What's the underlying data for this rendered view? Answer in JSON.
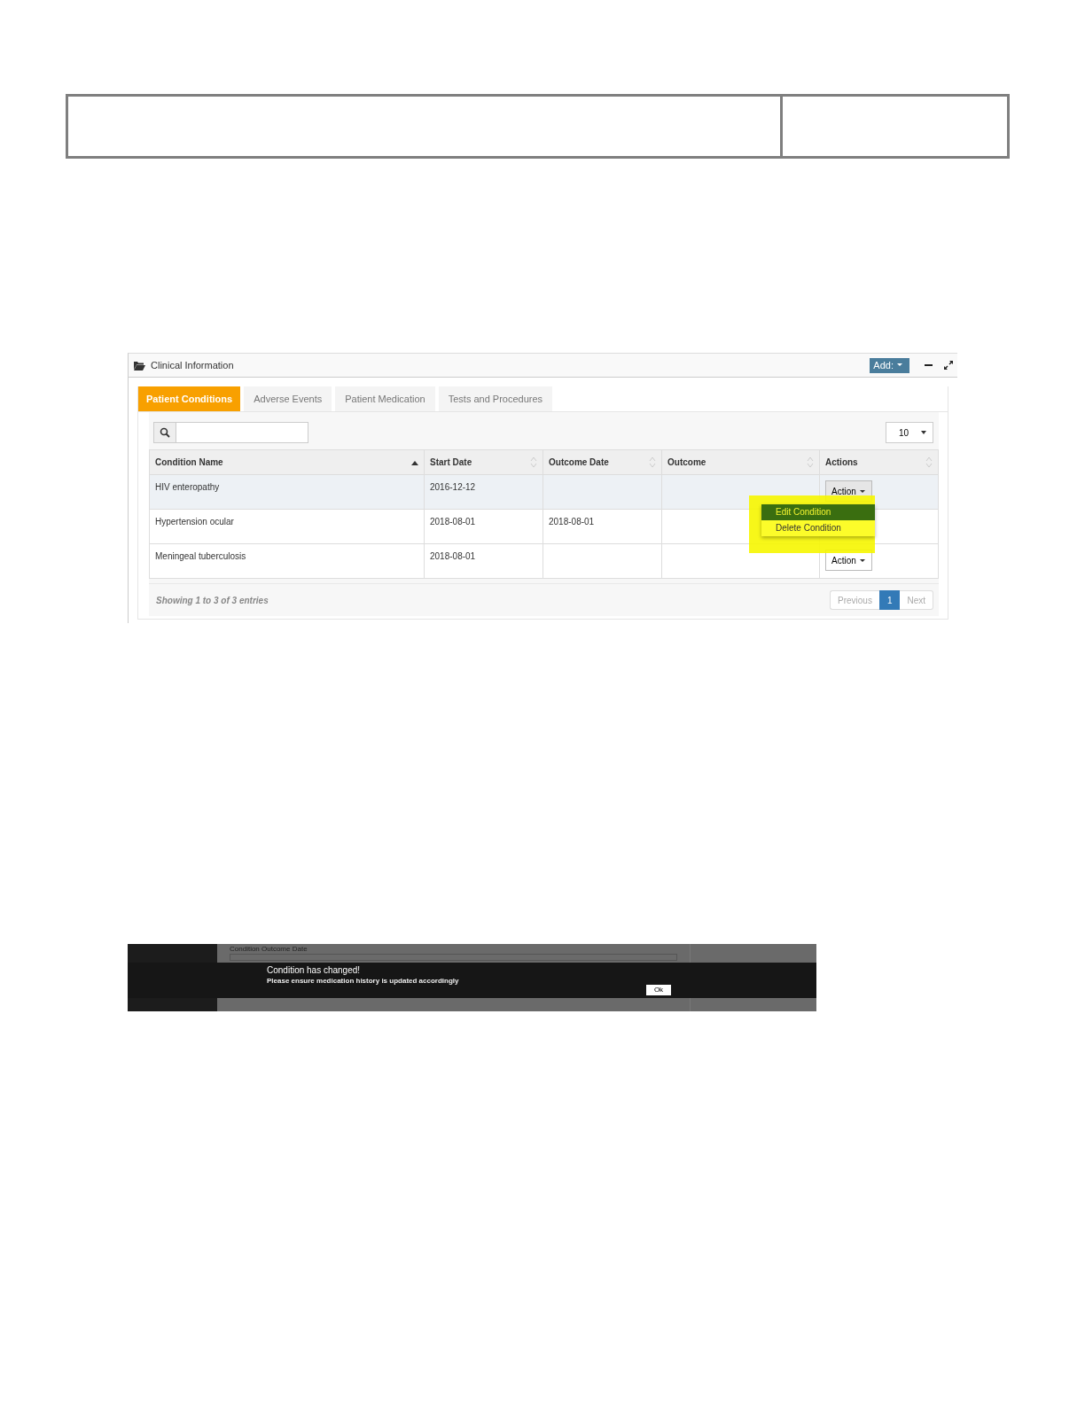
{
  "clinical_panel": {
    "title": "Clinical Information",
    "add_button": "Add:",
    "tabs": [
      {
        "label": "Patient Conditions",
        "selected": true
      },
      {
        "label": "Adverse Events",
        "selected": false
      },
      {
        "label": "Patient Medication",
        "selected": false
      },
      {
        "label": "Tests and Procedures",
        "selected": false
      }
    ],
    "page_length": "10",
    "table": {
      "columns": [
        {
          "label": "Condition Name",
          "sorted_ascending": true
        },
        {
          "label": "Start Date",
          "sorted_ascending": false
        },
        {
          "label": "Outcome Date",
          "sorted_ascending": false
        },
        {
          "label": "Outcome",
          "sorted_ascending": false
        },
        {
          "label": "Actions",
          "sorted_ascending": false
        }
      ],
      "rows": [
        {
          "condition": "HIV enteropathy",
          "start_date": "2016-12-12",
          "action": "Action",
          "selected": true
        },
        {
          "condition": "Hypertension ocular",
          "start_date": "2018-08-01",
          "outcome_date": "2018-08-01",
          "selected": false
        },
        {
          "condition": "Meningeal tuberculosis",
          "start_date": "2018-08-01",
          "action": "Action",
          "selected": false
        }
      ]
    },
    "action_menu": [
      {
        "label": "Edit Condition",
        "selected": true
      },
      {
        "label": "Delete Condition",
        "selected": false
      }
    ],
    "info": "Showing **1** to 3 of 3 entries",
    "pagination": [
      {
        "label": "Previous",
        "kind": "prev",
        "selected": false
      },
      {
        "label": "1",
        "kind": "page",
        "selected": true
      },
      {
        "label": "Next",
        "kind": "next",
        "selected": false
      }
    ]
  },
  "alert_screenshot": {
    "background_label": "Condition Outcome Date",
    "title": "Condition has changed!",
    "message": "Please ensure medication history is updated accordingly",
    "button": "Ok"
  }
}
